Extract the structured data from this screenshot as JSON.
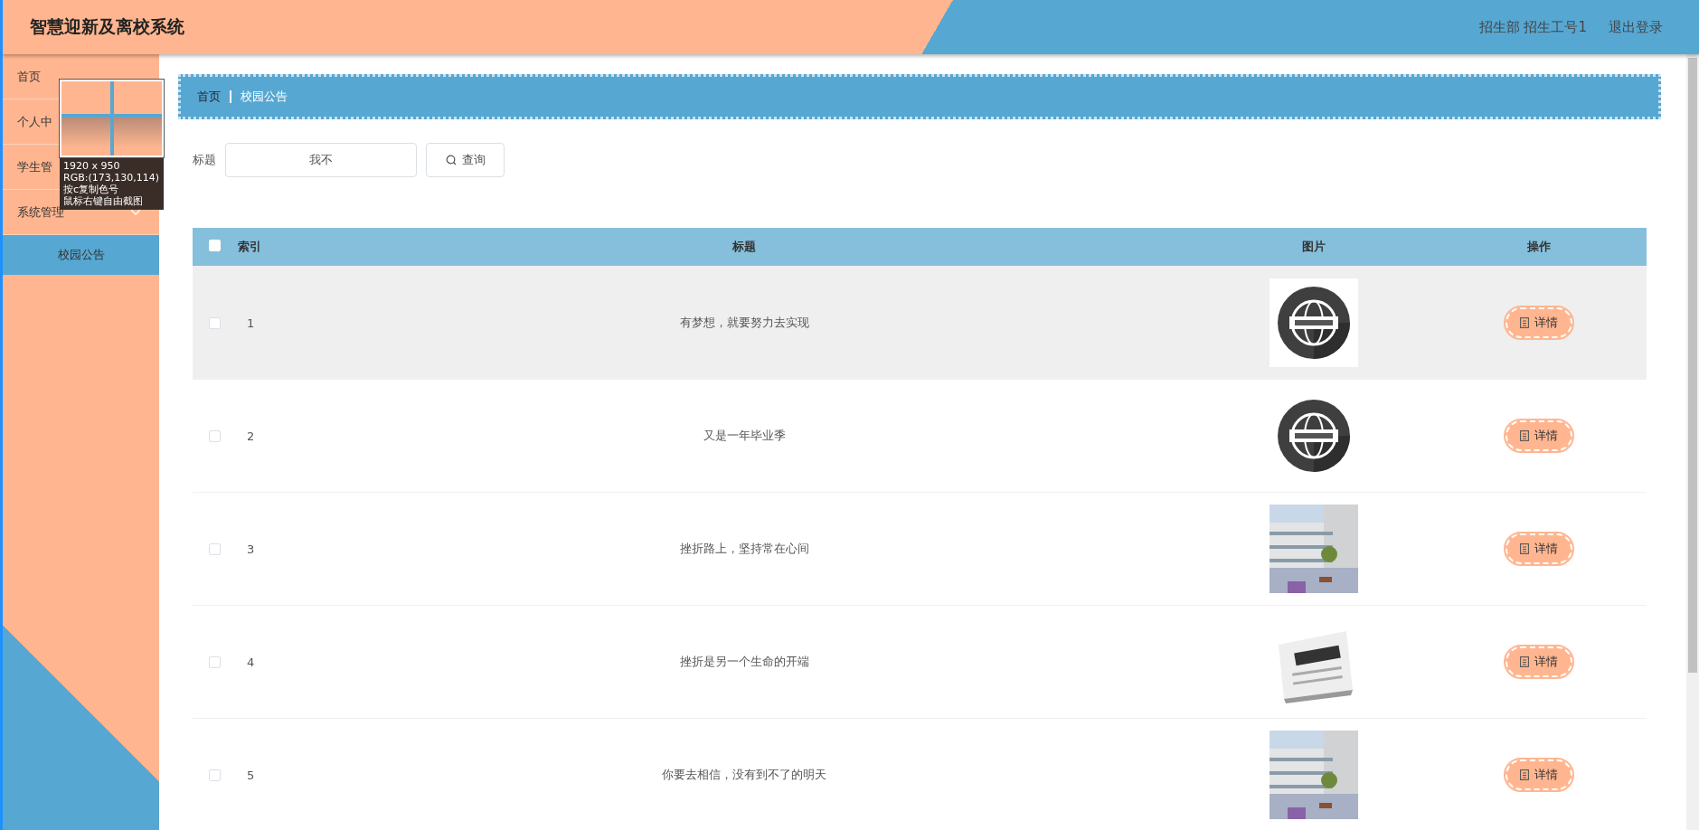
{
  "header": {
    "title": "智慧迎新及离校系统",
    "user": "招生部 招生工号1",
    "logout": "退出登录"
  },
  "sidebar": {
    "items": [
      {
        "label": "首页"
      },
      {
        "label": "个人中"
      },
      {
        "label": "学生管"
      },
      {
        "label": "系统管理",
        "expanded": true,
        "children": [
          {
            "label": "校园公告",
            "selected": true
          }
        ]
      }
    ]
  },
  "magnifier": {
    "size": "1920 x 950",
    "rgb": "RGB:(173,130,114)",
    "hint1": "按c复制色号",
    "hint2": "鼠标右键自由截图"
  },
  "breadcrumb": [
    "首页",
    "校园公告"
  ],
  "search": {
    "label": "标题",
    "value": "我不",
    "button": "查询"
  },
  "table": {
    "columns": [
      "索引",
      "标题",
      "图片",
      "操作"
    ],
    "all_checked": false,
    "rows": [
      {
        "index": "1",
        "title": "有梦想，就要努力去实现",
        "action": "详情",
        "checked": false,
        "hover": true
      },
      {
        "index": "2",
        "title": "又是一年毕业季",
        "action": "详情",
        "checked": false,
        "hover": false
      },
      {
        "index": "3",
        "title": "挫折路上，坚持常在心间",
        "action": "详情",
        "checked": false,
        "hover": false
      },
      {
        "index": "4",
        "title": "挫折是另一个生命的开端",
        "action": "详情",
        "checked": false,
        "hover": false
      },
      {
        "index": "5",
        "title": "你要去相信，没有到不了的明天",
        "action": "详情",
        "checked": false,
        "hover": false
      }
    ]
  }
}
